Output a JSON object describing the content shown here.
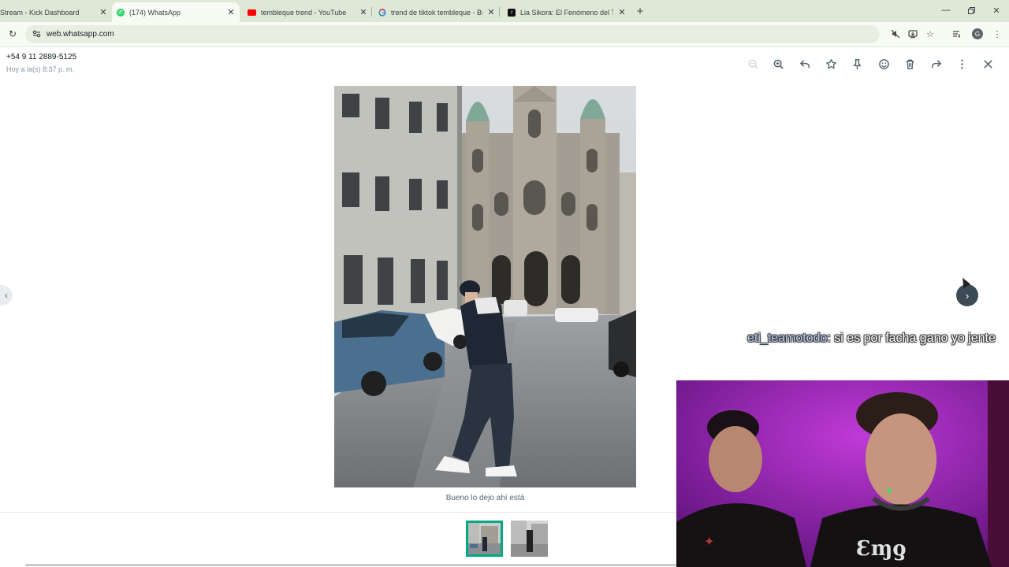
{
  "browser": {
    "tabs": [
      {
        "title": "Stream - Kick Dashboard",
        "favicon": "kick-icon",
        "active": false
      },
      {
        "title": "(174) WhatsApp",
        "favicon": "whatsapp-icon",
        "active": true
      },
      {
        "title": "tembleque trend - YouTube",
        "favicon": "youtube-icon",
        "active": false
      },
      {
        "title": "trend de tiktok tembleque - Bu",
        "favicon": "google-icon",
        "active": false
      },
      {
        "title": "Lia Sikora: El Fenómeno del Te",
        "favicon": "tiktok-icon",
        "active": false
      }
    ],
    "url": "web.whatsapp.com",
    "profile_initial": "G",
    "colors": {
      "tabstrip": "#dee8d6",
      "toolbar": "#f8fbf4"
    }
  },
  "viewer": {
    "sender": "+54 9 11 2889-5125",
    "timestamp": "Hoy a la(s) 8:37 p. m.",
    "caption": "Bueno lo dejo ahí está",
    "toolbar_icons": [
      "zoom-out-icon",
      "zoom-in-icon",
      "reply-icon",
      "star-icon",
      "pin-icon",
      "emoji-react-icon",
      "delete-icon",
      "forward-icon",
      "more-options-icon",
      "close-icon"
    ],
    "thumbnails": [
      "street-photo-thumbnail",
      "second-photo-thumbnail"
    ],
    "selected_thumbnail": 0,
    "accent_color": "#00a884"
  },
  "stream_overlay": {
    "chat_user": "eti_teamotodo",
    "chat_message": ": si es por facha gano yo jente"
  }
}
